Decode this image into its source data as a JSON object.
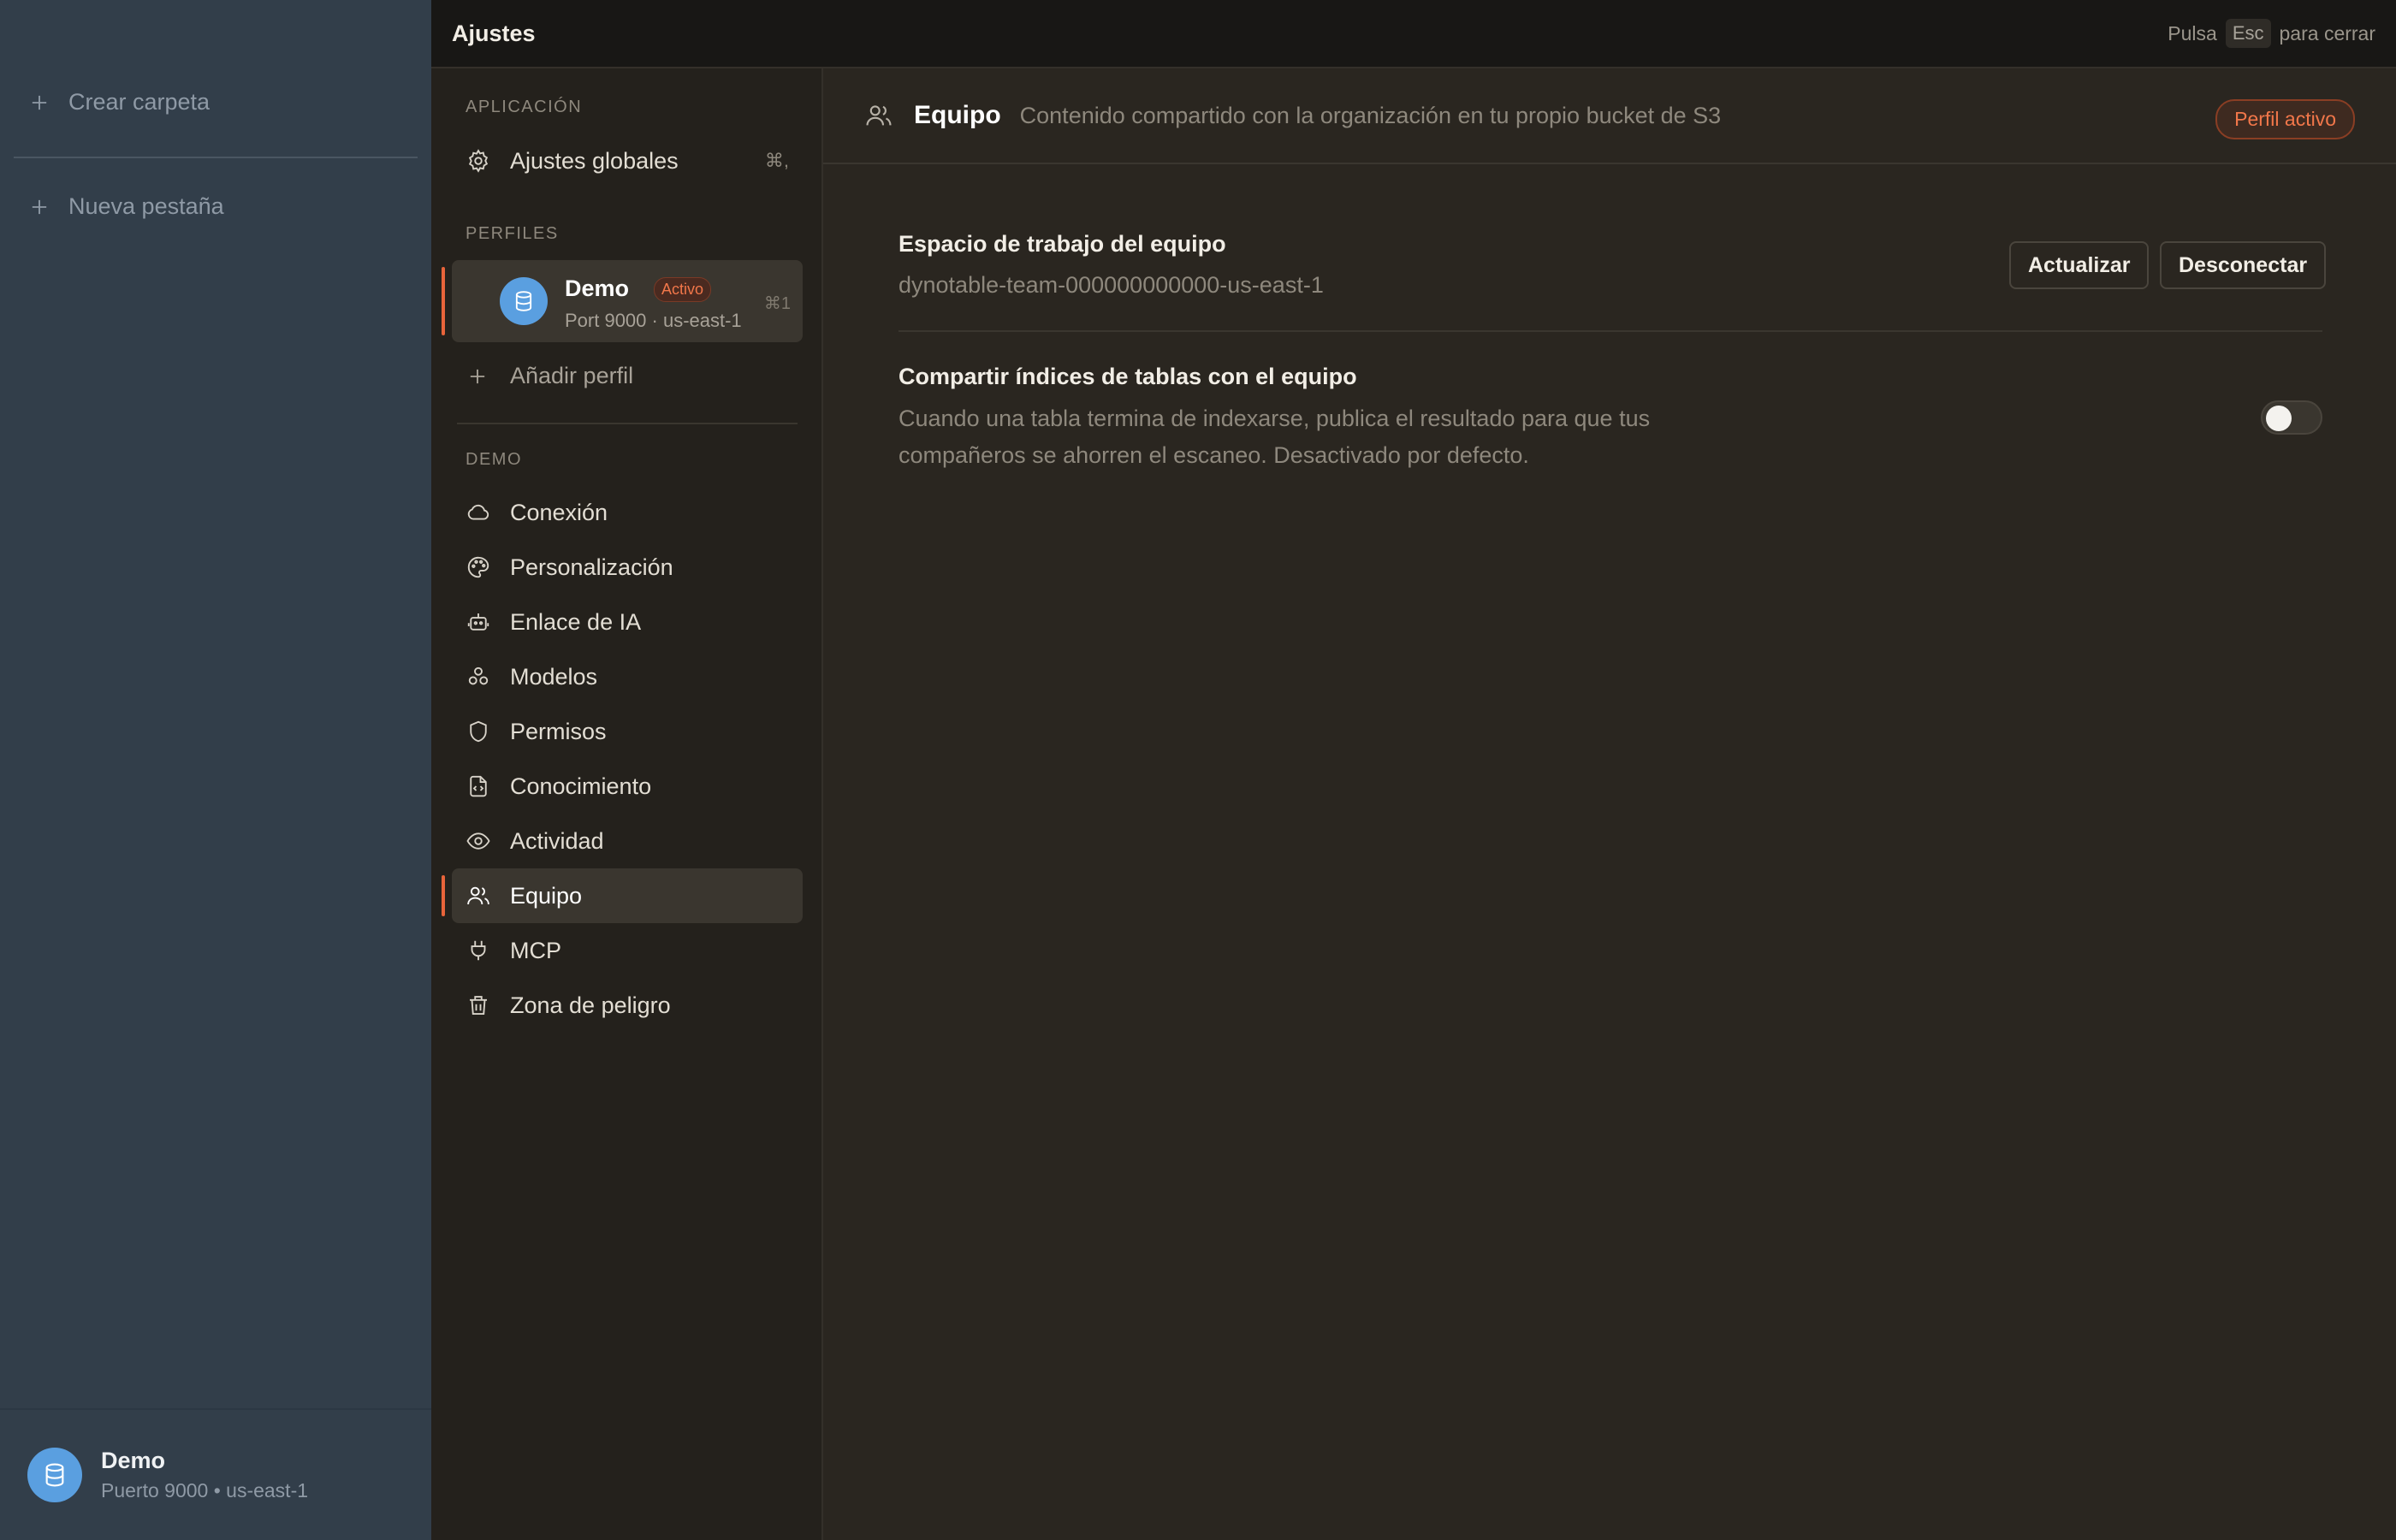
{
  "app_sidebar": {
    "create_folder_label": "Crear carpeta",
    "new_tab_label": "Nueva pestaña",
    "footer": {
      "name": "Demo",
      "sub": "Puerto 9000 • us-east-1"
    }
  },
  "topbar": {
    "title": "Ajustes",
    "hint_press": "Pulsa",
    "hint_key": "Esc",
    "hint_close": "para cerrar"
  },
  "nav": {
    "section_app": "APLICACIÓN",
    "global_settings_label": "Ajustes globales",
    "global_settings_shortcut": "⌘,",
    "section_profiles": "PERFILES",
    "profile": {
      "name": "Demo",
      "badge": "Activo",
      "sub": "Port 9000 · us-east-1",
      "shortcut": "⌘1"
    },
    "add_profile_label": "Añadir perfil",
    "section_demo": "DEMO",
    "items": [
      {
        "label": "Conexión",
        "icon": "cloud-icon"
      },
      {
        "label": "Personalización",
        "icon": "palette-icon"
      },
      {
        "label": "Enlace de IA",
        "icon": "robot-icon"
      },
      {
        "label": "Modelos",
        "icon": "cubes-icon"
      },
      {
        "label": "Permisos",
        "icon": "shield-icon"
      },
      {
        "label": "Conocimiento",
        "icon": "document-code-icon"
      },
      {
        "label": "Actividad",
        "icon": "eye-icon"
      },
      {
        "label": "Equipo",
        "icon": "users-icon",
        "active": true
      },
      {
        "label": "MCP",
        "icon": "plug-icon"
      },
      {
        "label": "Zona de peligro",
        "icon": "trash-icon"
      }
    ]
  },
  "main": {
    "title": "Equipo",
    "description": "Contenido compartido con la organización en tu propio bucket de S3",
    "profile_pill": "Perfil activo",
    "workspace": {
      "title": "Espacio de trabajo del equipo",
      "value": "dynotable-team-000000000000-us-east-1",
      "update_label": "Actualizar",
      "disconnect_label": "Desconectar"
    },
    "share_indexes": {
      "title": "Compartir índices de tablas con el equipo",
      "description": "Cuando una tabla termina de indexarse, publica el resultado para que tus compañeros se ahorren el escaneo. Desactivado por defecto.",
      "enabled": false
    }
  },
  "colors": {
    "accent": "#e8643a",
    "avatar": "#5a9fe0",
    "app_sidebar_bg": "#323e4a",
    "panel_bg": "#2a2620"
  }
}
